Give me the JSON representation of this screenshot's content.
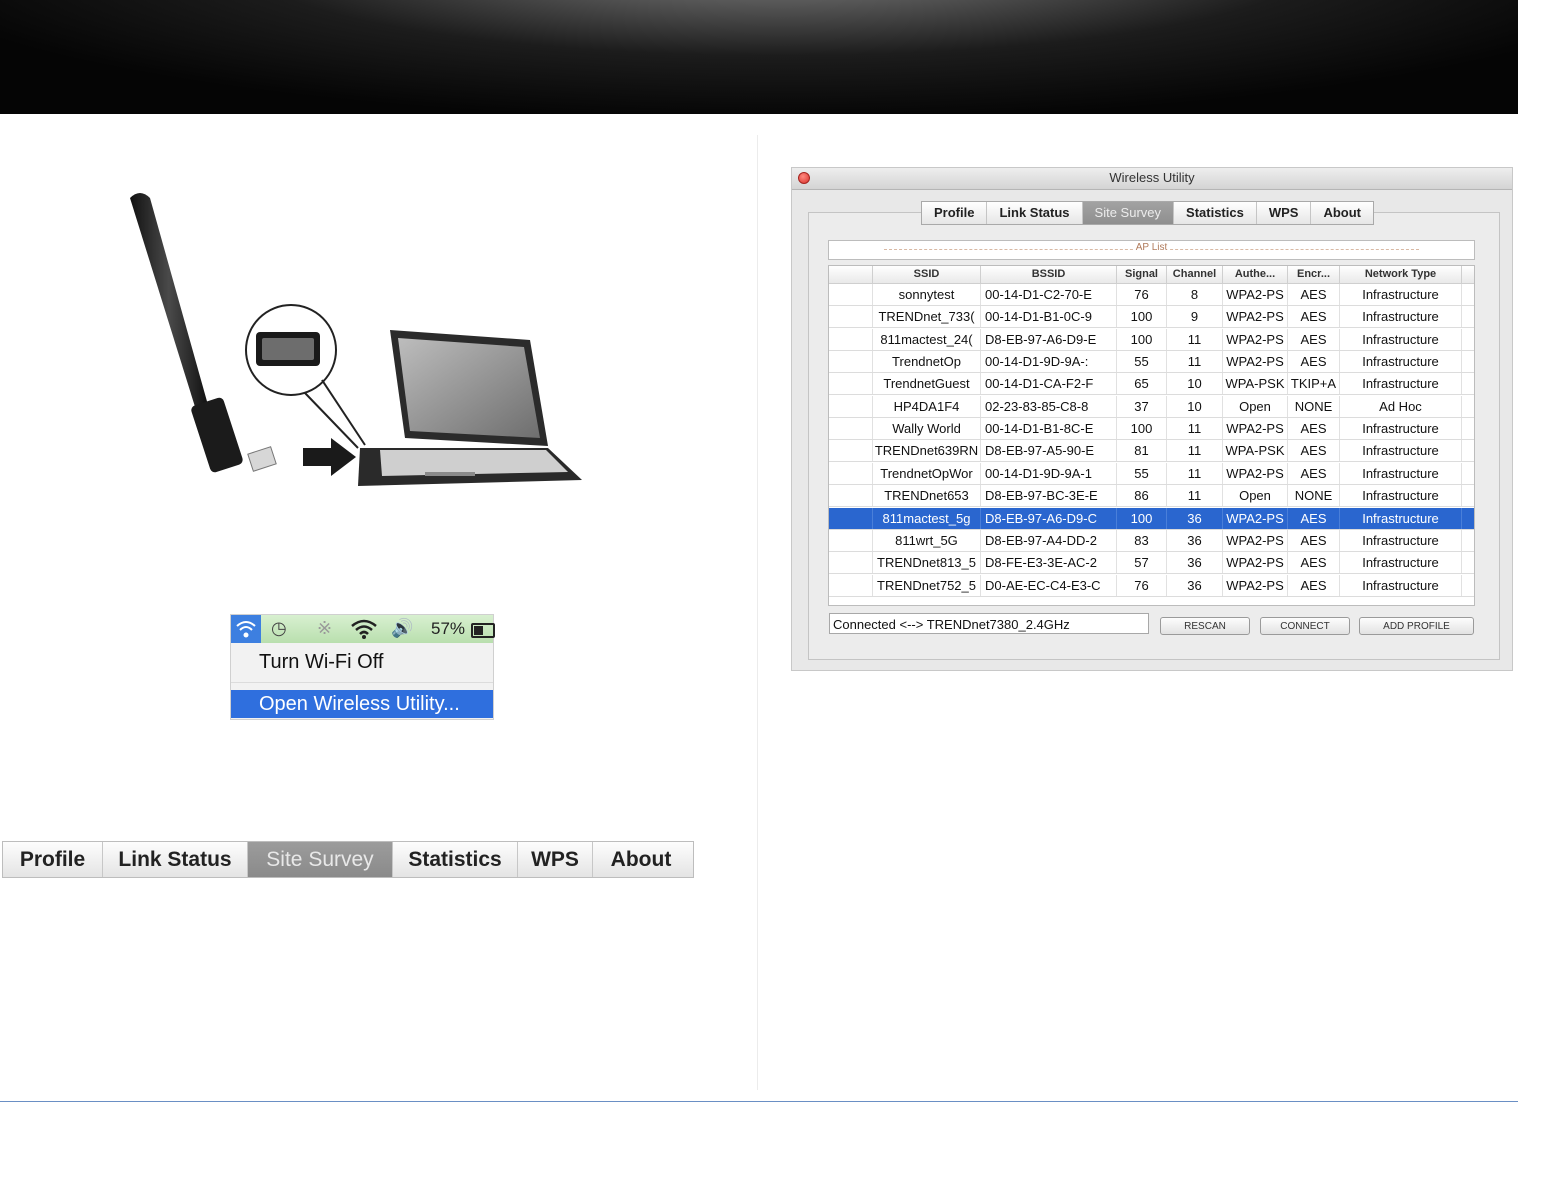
{
  "colors": {
    "selection": "#2a66cf",
    "menu_highlight": "#2f6fde",
    "active_tab": "#8f8f8f",
    "footer_rule": "#6a8fc4"
  },
  "menu_bar": {
    "battery_percent": "57%",
    "icons": [
      "wifi-icon",
      "time-machine-icon",
      "bluetooth-icon",
      "wifi-signal-icon",
      "volume-icon",
      "battery-icon"
    ],
    "items": [
      "Turn Wi-Fi Off",
      "Open Wireless Utility..."
    ]
  },
  "tabs_large": [
    "Profile",
    "Link Status",
    "Site Survey",
    "Statistics",
    "WPS",
    "About"
  ],
  "window": {
    "title": "Wireless Utility",
    "tabs": [
      "Profile",
      "Link Status",
      "Site Survey",
      "Statistics",
      "WPS",
      "About"
    ],
    "active_tab": "Site Survey",
    "ap_list_caption": "AP List",
    "columns": [
      "SSID",
      "BSSID",
      "Signal",
      "Channel",
      "Authe...",
      "Encr...",
      "Network Type"
    ],
    "rows": [
      [
        "sonnytest",
        "00-14-D1-C2-70-E",
        "76",
        "8",
        "WPA2-PS",
        "AES",
        "Infrastructure"
      ],
      [
        "TRENDnet_733(",
        "00-14-D1-B1-0C-9",
        "100",
        "9",
        "WPA2-PS",
        "AES",
        "Infrastructure"
      ],
      [
        "811mactest_24(",
        "D8-EB-97-A6-D9-E",
        "100",
        "11",
        "WPA2-PS",
        "AES",
        "Infrastructure"
      ],
      [
        "TrendnetOp",
        "00-14-D1-9D-9A-:",
        "55",
        "11",
        "WPA2-PS",
        "AES",
        "Infrastructure"
      ],
      [
        "TrendnetGuest",
        "00-14-D1-CA-F2-F",
        "65",
        "10",
        "WPA-PSK",
        "TKIP+A",
        "Infrastructure"
      ],
      [
        "HP4DA1F4",
        "02-23-83-85-C8-8",
        "37",
        "10",
        "Open",
        "NONE",
        "Ad Hoc"
      ],
      [
        "Wally World",
        "00-14-D1-B1-8C-E",
        "100",
        "11",
        "WPA2-PS",
        "AES",
        "Infrastructure"
      ],
      [
        "TRENDnet639RN",
        "D8-EB-97-A5-90-E",
        "81",
        "11",
        "WPA-PSK",
        "AES",
        "Infrastructure"
      ],
      [
        "TrendnetOpWor",
        "00-14-D1-9D-9A-1",
        "55",
        "11",
        "WPA2-PS",
        "AES",
        "Infrastructure"
      ],
      [
        "TRENDnet653",
        "D8-EB-97-BC-3E-E",
        "86",
        "11",
        "Open",
        "NONE",
        "Infrastructure"
      ],
      [
        "811mactest_5g",
        "D8-EB-97-A6-D9-C",
        "100",
        "36",
        "WPA2-PS",
        "AES",
        "Infrastructure"
      ],
      [
        "811wrt_5G",
        "D8-EB-97-A4-DD-2",
        "83",
        "36",
        "WPA2-PS",
        "AES",
        "Infrastructure"
      ],
      [
        "TRENDnet813_5",
        "D8-FE-E3-3E-AC-2",
        "57",
        "36",
        "WPA2-PS",
        "AES",
        "Infrastructure"
      ],
      [
        "TRENDnet752_5",
        "D0-AE-EC-C4-E3-C",
        "76",
        "36",
        "WPA2-PS",
        "AES",
        "Infrastructure"
      ]
    ],
    "selected_row": 10,
    "status": "Connected <--> TRENDnet7380_2.4GHz",
    "buttons": {
      "rescan": "RESCAN",
      "connect": "CONNECT",
      "add_profile": "ADD PROFILE"
    }
  }
}
